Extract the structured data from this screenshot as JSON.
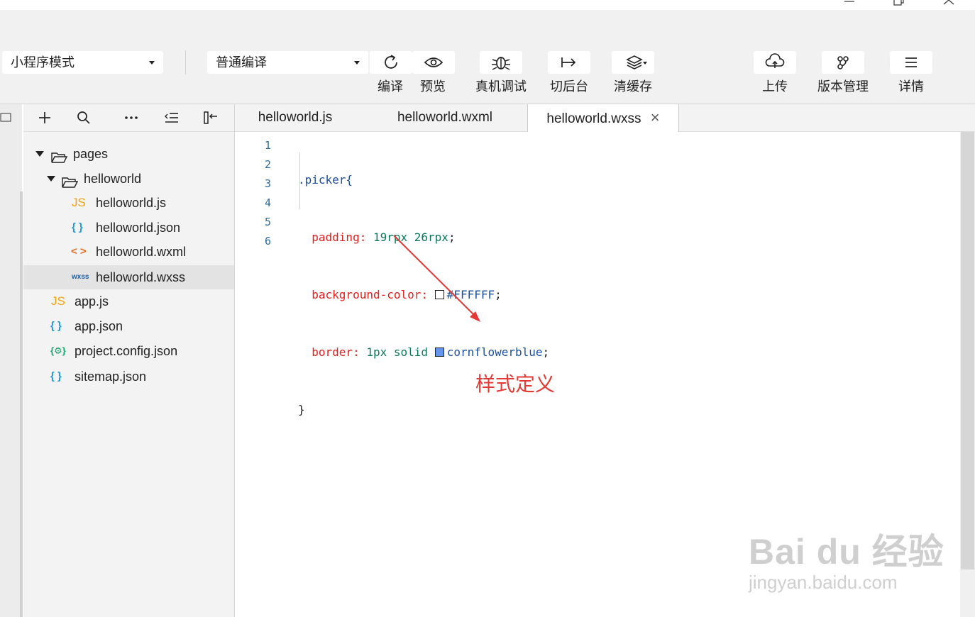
{
  "window": {
    "controls": [
      "minimize",
      "restore",
      "close"
    ]
  },
  "toolbar": {
    "mode_select": "小程序模式",
    "compile_select": "普通编译",
    "buttons": [
      {
        "label": "编译",
        "icon": "refresh-icon"
      },
      {
        "label": "预览",
        "icon": "eye-icon"
      },
      {
        "label": "真机调试",
        "icon": "bug-icon"
      },
      {
        "label": "切后台",
        "icon": "switch-background-icon"
      },
      {
        "label": "清缓存",
        "icon": "layers-icon"
      },
      {
        "label": "上传",
        "icon": "cloud-upload-icon"
      },
      {
        "label": "版本管理",
        "icon": "version-branch-icon"
      },
      {
        "label": "详情",
        "icon": "menu-lines-icon"
      }
    ]
  },
  "explorer": {
    "toolbar_icons": [
      "plus-icon",
      "search-icon",
      "more-icon",
      "outdent-icon",
      "collapse-panel-icon"
    ],
    "tree": [
      {
        "name": "pages",
        "type": "folder",
        "icon": "folder-open-icon"
      },
      {
        "name": "helloworld",
        "type": "folder",
        "icon": "folder-open-icon"
      },
      {
        "name": "helloworld.js",
        "type": "js",
        "badge": "JS"
      },
      {
        "name": "helloworld.json",
        "type": "json",
        "badge": "{ }"
      },
      {
        "name": "helloworld.wxml",
        "type": "wxml",
        "badge": "< >"
      },
      {
        "name": "helloworld.wxss",
        "type": "wxss",
        "badge": "wxss",
        "active": true
      },
      {
        "name": "app.js",
        "type": "js",
        "badge": "JS"
      },
      {
        "name": "app.json",
        "type": "json",
        "badge": "{ }"
      },
      {
        "name": "project.config.json",
        "type": "config",
        "badge": "{⚙}"
      },
      {
        "name": "sitemap.json",
        "type": "json",
        "badge": "{ }"
      }
    ]
  },
  "tabs": [
    {
      "label": "helloworld.js"
    },
    {
      "label": "helloworld.wxml"
    },
    {
      "label": "helloworld.wxss",
      "active": true,
      "close": "×"
    }
  ],
  "editor": {
    "line_numbers": [
      "1",
      "2",
      "3",
      "4",
      "5",
      "6"
    ],
    "selector": ".picker{",
    "line2_prop": "padding:",
    "line2_val": "19rpx 26rpx",
    "line3_prop": "background-color:",
    "line3_val": "#FFFFFF",
    "line3_swatch": "#FFFFFF",
    "line4_prop": "border:",
    "line4_val1": "1px solid",
    "line4_val2": "cornflowerblue",
    "line4_swatch": "#6495ED",
    "semicolon": ";",
    "close_brace": "}"
  },
  "annotation": {
    "text": "样式定义",
    "color": "#e53935"
  },
  "watermark": {
    "line1": "Bai du 经验",
    "line2": "jingyan.baidu.com"
  },
  "colors": {
    "toolbar_bg": "#f1f1f1",
    "explorer_bg": "#f3f3f3",
    "active_row": "#e3e3e3",
    "js_badge": "#f0a30a",
    "json_badge": "#1e9bd7",
    "wxml_badge": "#e8691b",
    "wxss_badge": "#1c5fa8",
    "config_badge": "#13a36f"
  }
}
